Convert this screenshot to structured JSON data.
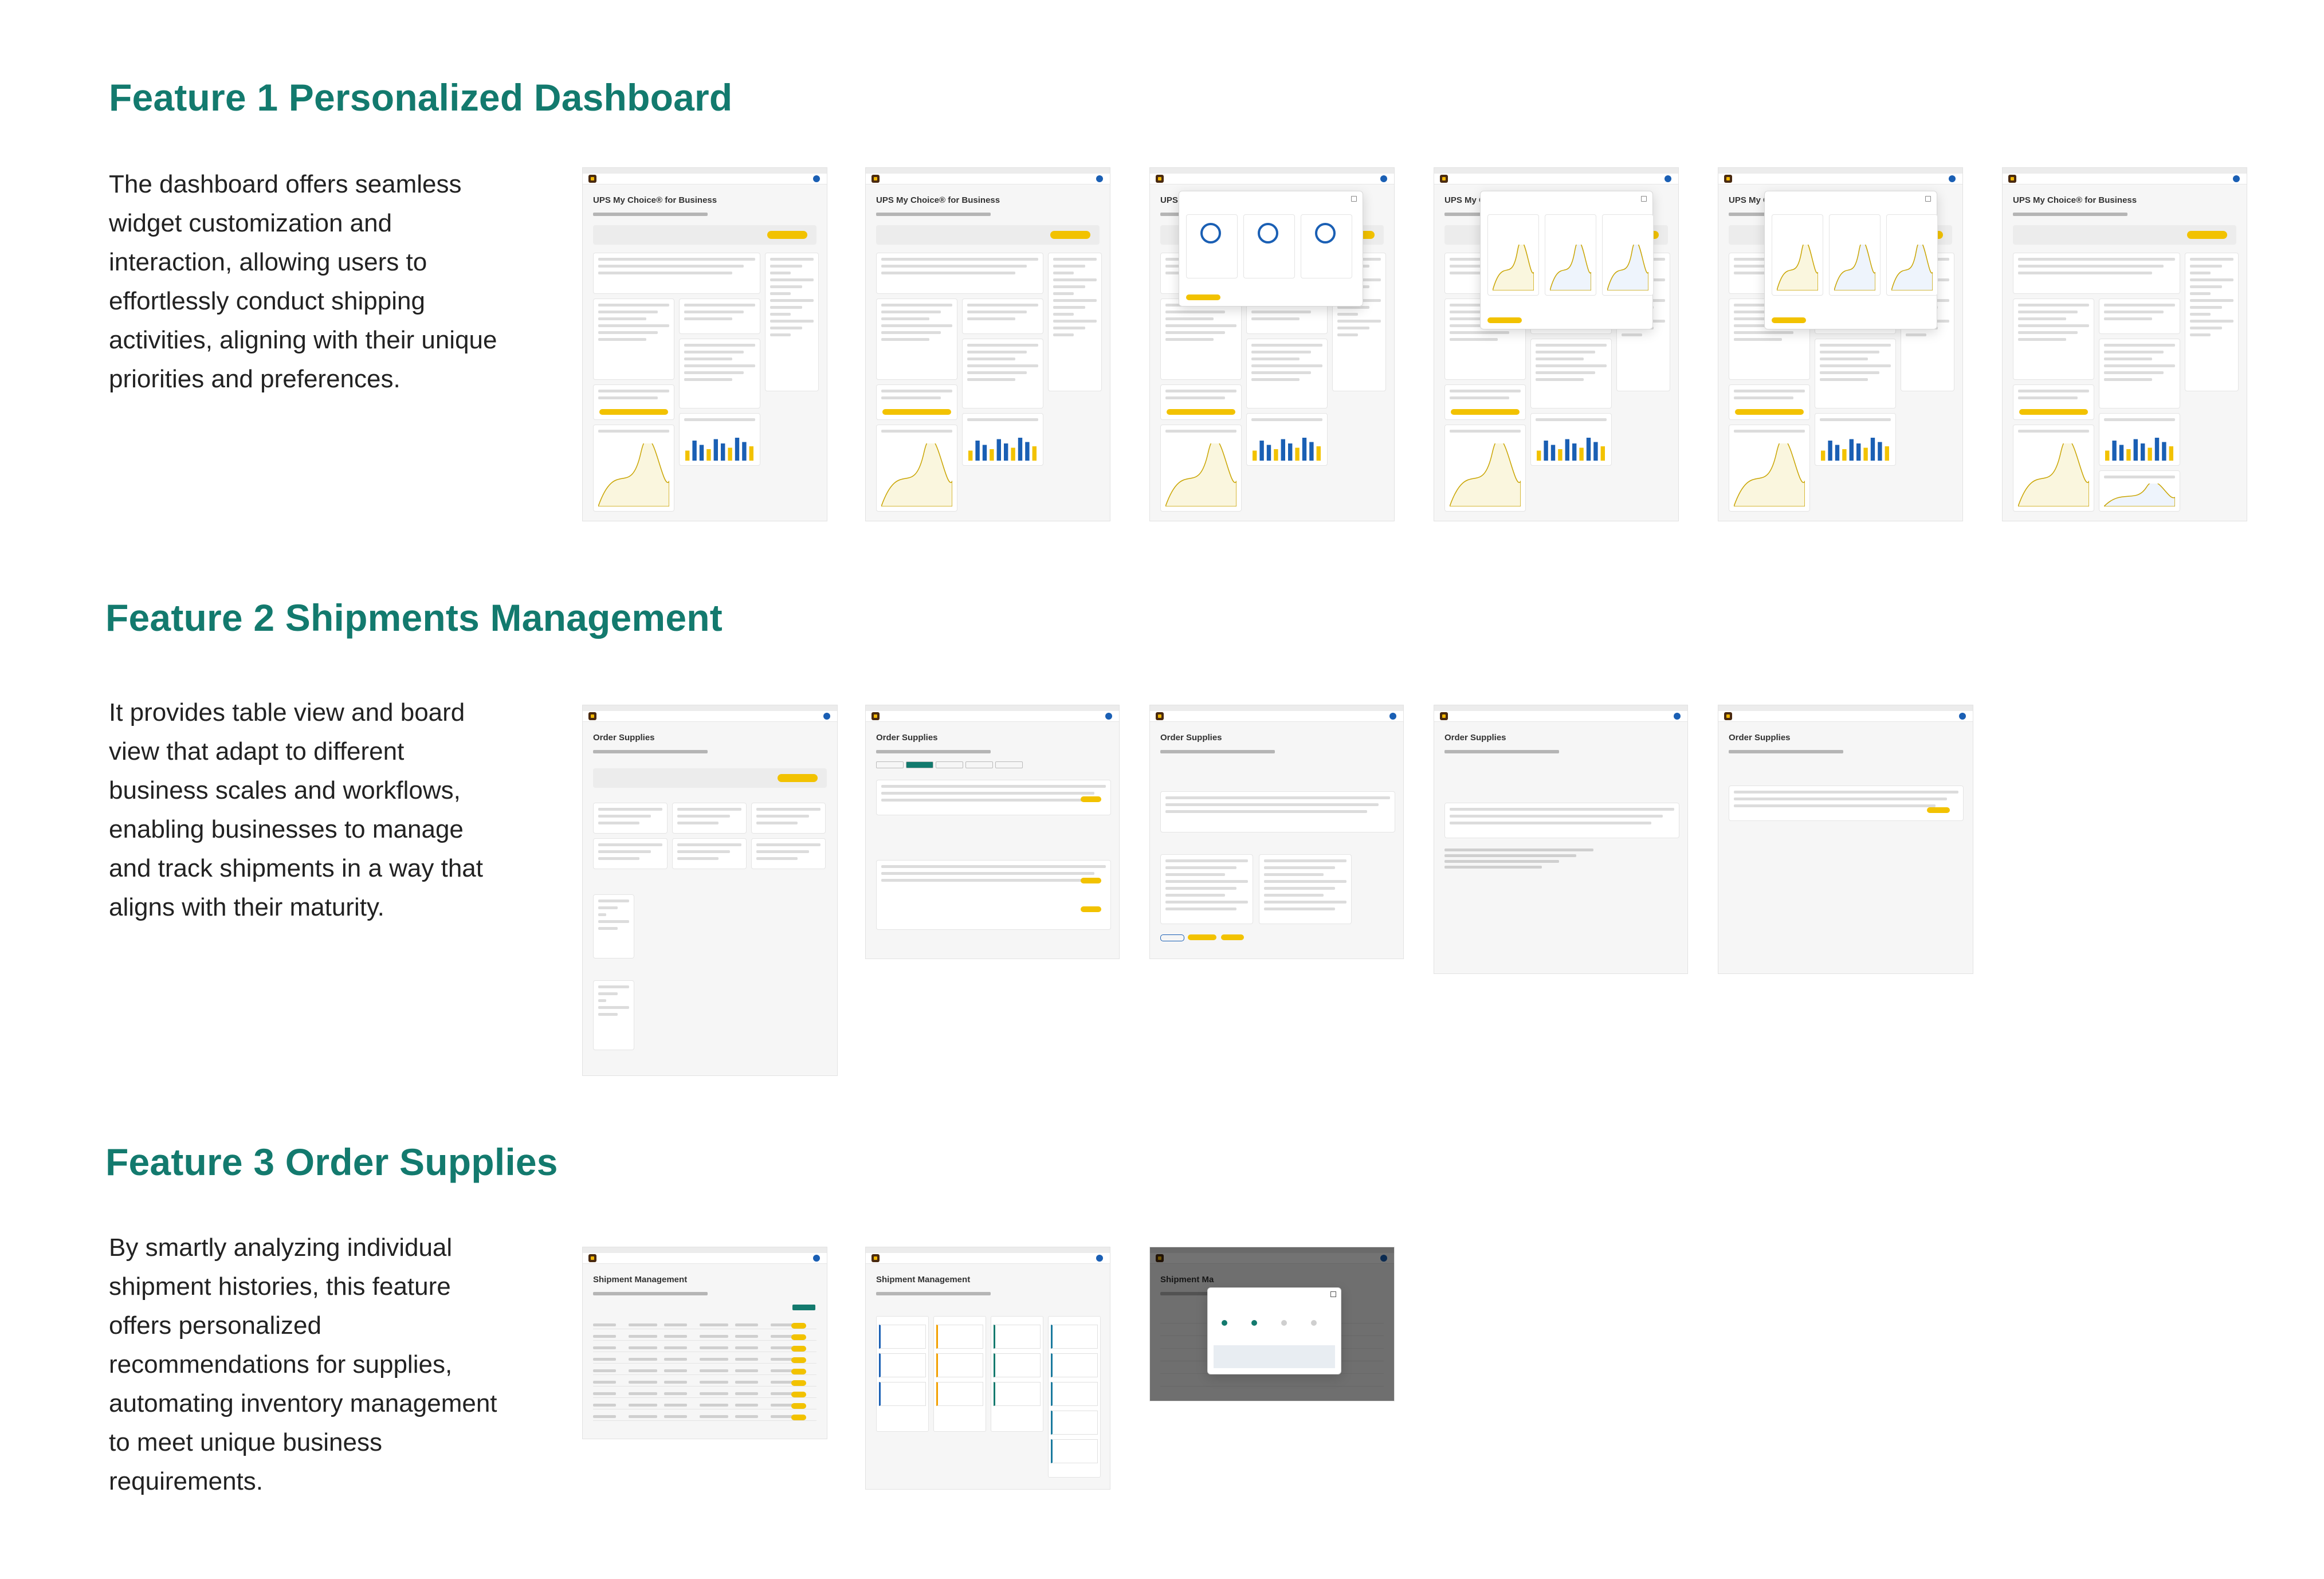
{
  "features": [
    {
      "title": "Feature 1 Personalized Dashboard",
      "description": "The dashboard offers seamless widget customization and interaction, allowing users to effortlessly conduct shipping activities, aligning with their unique priorities and preferences.",
      "screen_titles": [
        "UPS My Choice® for Business",
        "UPS My Choice® for Business",
        "UPS My C",
        "UPS My C",
        "UPS My C",
        "UPS My Choice® for Business"
      ]
    },
    {
      "title": "Feature 2 Shipments Management",
      "description": "It provides table view and board view that adapt to different business scales and workflows, enabling businesses to manage and track shipments in a way that aligns with their maturity.",
      "screen_titles": [
        "Order Supplies",
        "Order Supplies",
        "Order Supplies",
        "Order Supplies",
        "Order Supplies"
      ]
    },
    {
      "title": "Feature 3 Order Supplies",
      "description": "By smartly analyzing individual shipment histories, this feature offers personalized recommendations for supplies, automating inventory management to meet unique business requirements.",
      "screen_titles": [
        "Shipment Management",
        "Shipment Management",
        "Shipment Ma"
      ]
    }
  ]
}
